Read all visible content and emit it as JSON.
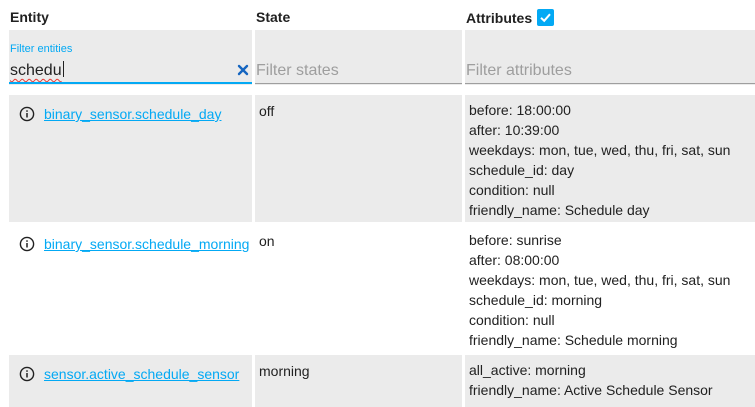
{
  "headers": {
    "entity": "Entity",
    "state": "State",
    "attributes": "Attributes",
    "attributes_checked": true
  },
  "filters": {
    "entity_label": "Filter entities",
    "entity_value": "schedu",
    "state_placeholder": "Filter states",
    "attributes_placeholder": "Filter attributes"
  },
  "colors": {
    "accent": "#03a9f4",
    "row_background": "#ebebeb",
    "spellcheck_underline": "#e53935"
  },
  "rows": [
    {
      "entity": "binary_sensor.schedule_day",
      "state": "off",
      "attributes": [
        "before: 18:00:00",
        "after: 10:39:00",
        "weekdays: mon, tue, wed, thu, fri, sat, sun",
        "schedule_id: day",
        "condition: null",
        "friendly_name: Schedule day"
      ]
    },
    {
      "entity": "binary_sensor.schedule_morning",
      "state": "on",
      "attributes": [
        "before: sunrise",
        "after: 08:00:00",
        "weekdays: mon, tue, wed, thu, fri, sat, sun",
        "schedule_id: morning",
        "condition: null",
        "friendly_name: Schedule morning"
      ]
    },
    {
      "entity": "sensor.active_schedule_sensor",
      "state": "morning",
      "attributes": [
        "all_active: morning",
        "friendly_name: Active Schedule Sensor"
      ]
    }
  ]
}
